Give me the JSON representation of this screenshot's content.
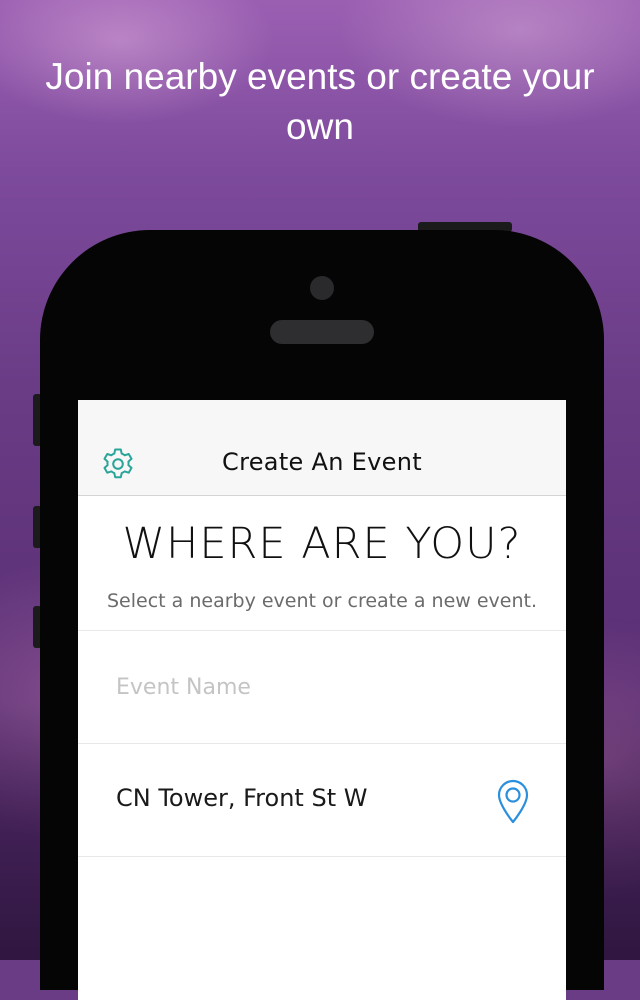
{
  "promo": {
    "headline": "Join nearby events or create your own"
  },
  "navbar": {
    "title": "Create An Event",
    "settings_icon": "gear-icon"
  },
  "hero": {
    "title": "WHERE ARE YOU?",
    "subtitle": "Select a nearby event or create a new event."
  },
  "form": {
    "event_name": {
      "value": "",
      "placeholder": "Event Name"
    },
    "location": {
      "value": "CN Tower, Front St W",
      "icon": "location-pin-icon"
    }
  },
  "colors": {
    "accent_teal": "#2aa59a",
    "accent_blue": "#2b8fdc",
    "background_purple": "#6a3c86"
  }
}
